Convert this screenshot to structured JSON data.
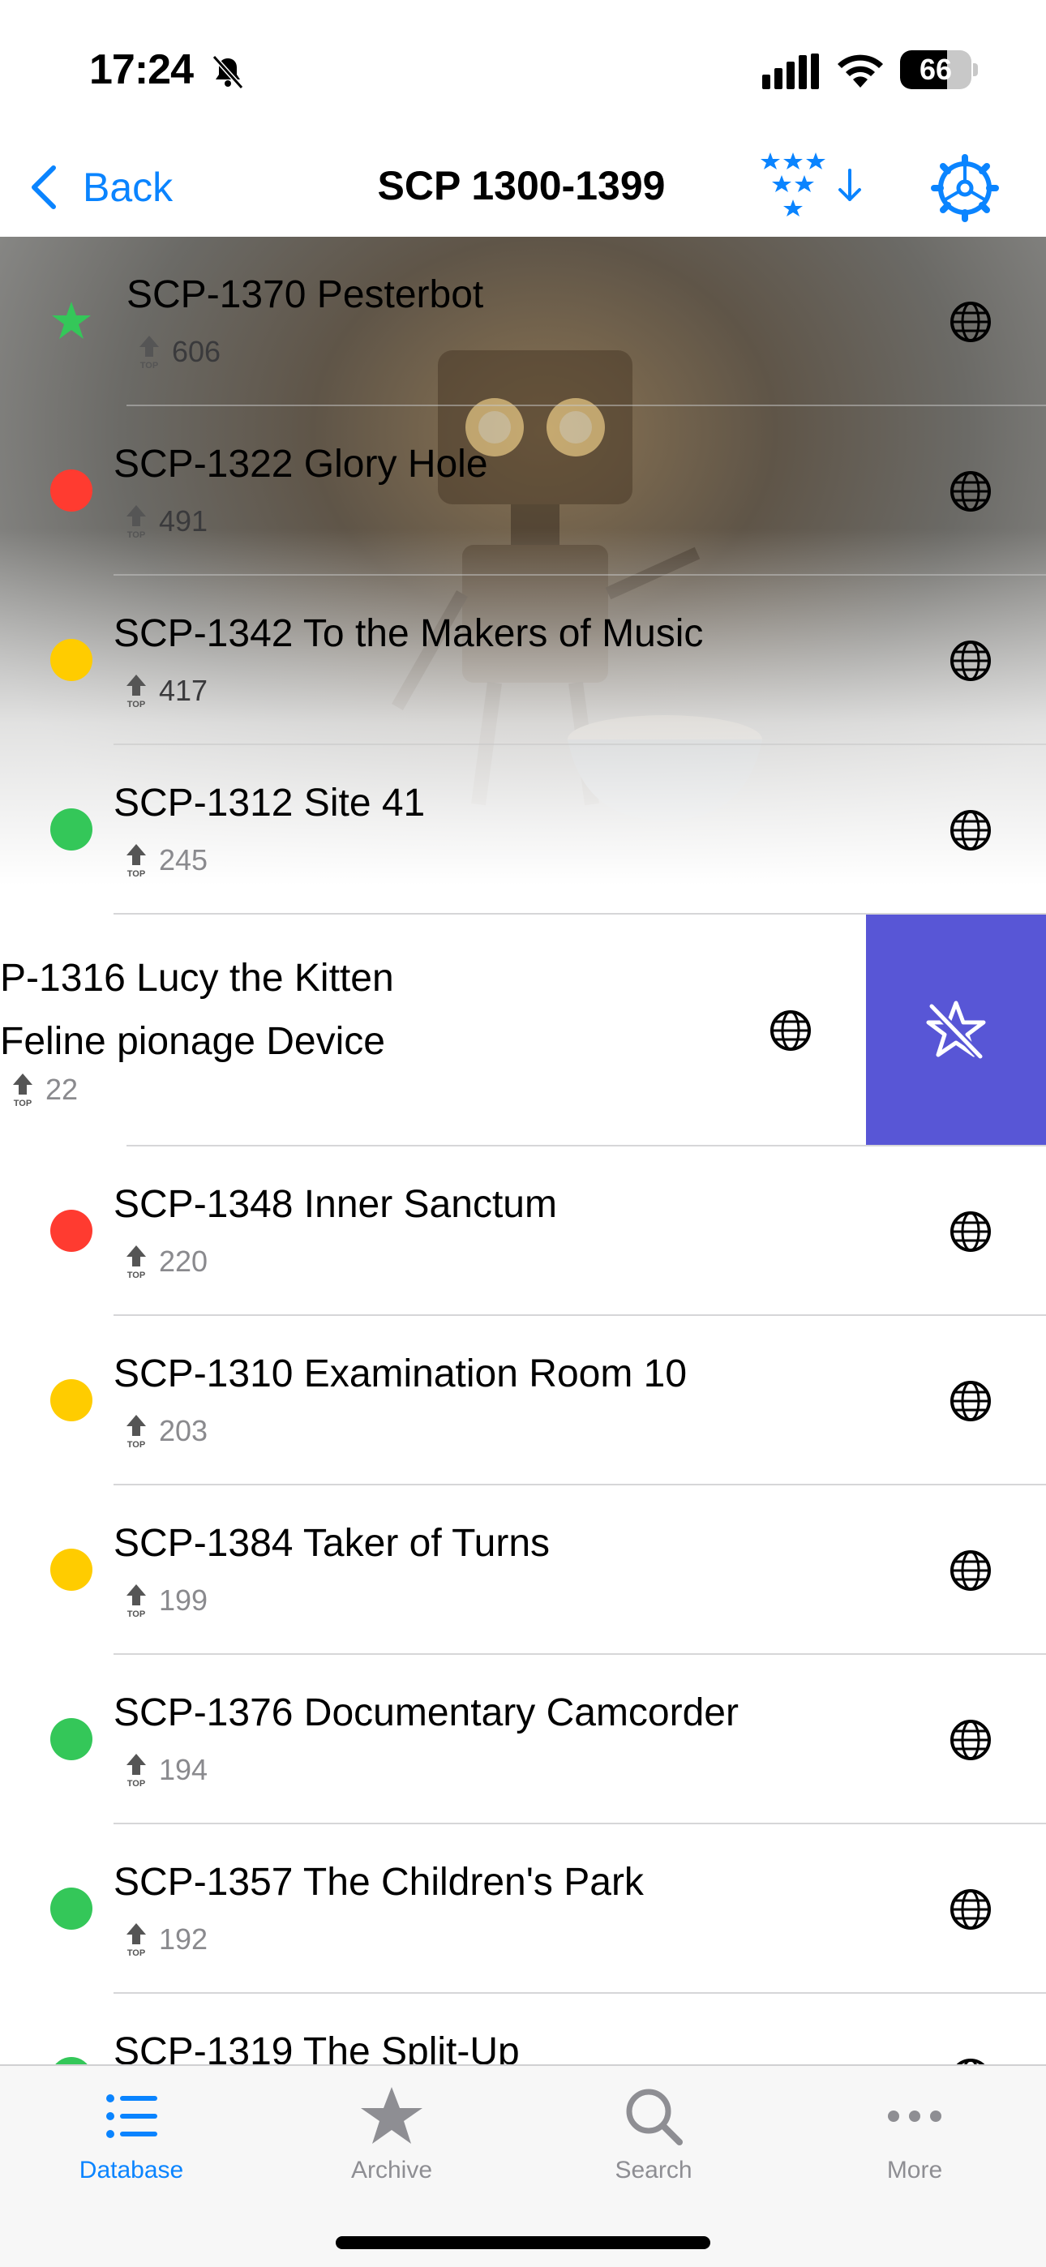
{
  "status": {
    "time": "17:24",
    "battery": "66",
    "battery_level": 0.66
  },
  "nav": {
    "back_label": "Back",
    "title": "SCP 1300-1399"
  },
  "rows": [
    {
      "title": "SCP-1370 Pesterbot",
      "rating": "606",
      "marker": "star",
      "color": "#34c759"
    },
    {
      "title": "SCP-1322 Glory Hole",
      "rating": "491",
      "marker": "dot",
      "color": "#ff3b30"
    },
    {
      "title": "SCP-1342 To the Makers of Music",
      "rating": "417",
      "marker": "dot",
      "color": "#ffcc00"
    },
    {
      "title": "SCP-1312 Site 41",
      "rating": "245",
      "marker": "dot",
      "color": "#34c759"
    },
    {
      "title": "P-1316 Lucy the Kitten Feline pionage Device",
      "rating": "22",
      "marker": "none",
      "color": ""
    },
    {
      "title": "SCP-1348 Inner Sanctum",
      "rating": "220",
      "marker": "dot",
      "color": "#ff3b30"
    },
    {
      "title": "SCP-1310 Examination Room 10",
      "rating": "203",
      "marker": "dot",
      "color": "#ffcc00"
    },
    {
      "title": "SCP-1384 Taker of Turns",
      "rating": "199",
      "marker": "dot",
      "color": "#ffcc00"
    },
    {
      "title": "SCP-1376 Documentary Camcorder",
      "rating": "194",
      "marker": "dot",
      "color": "#34c759"
    },
    {
      "title": "SCP-1357 The Children's Park",
      "rating": "192",
      "marker": "dot",
      "color": "#34c759"
    },
    {
      "title": "SCP-1319 The Split-Up",
      "rating": "",
      "marker": "dot",
      "color": "#34c759"
    }
  ],
  "swipe_action_color": "#5856d6",
  "tabs": [
    {
      "label": "Database",
      "icon": "list-icon",
      "active": true
    },
    {
      "label": "Archive",
      "icon": "star-icon",
      "active": false
    },
    {
      "label": "Search",
      "icon": "magnifier-icon",
      "active": false
    },
    {
      "label": "More",
      "icon": "ellipsis-icon",
      "active": false
    }
  ]
}
